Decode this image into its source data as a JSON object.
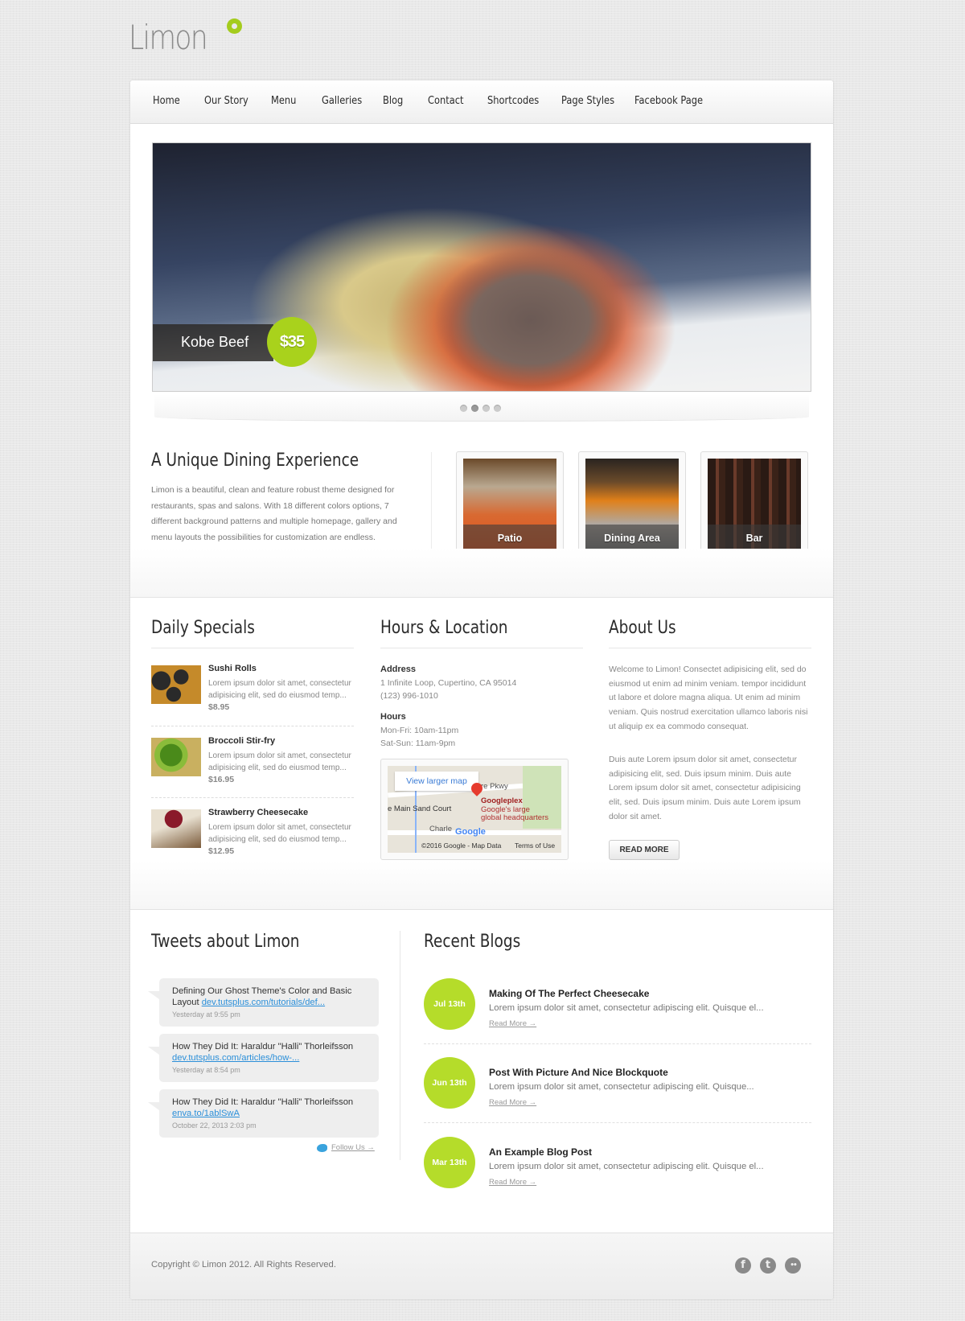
{
  "brand": {
    "name": "Limon",
    "accent": "#a9d21c"
  },
  "nav": {
    "items": [
      {
        "label": "Home"
      },
      {
        "label": "Our Story"
      },
      {
        "label": "Menu"
      },
      {
        "label": "Galleries"
      },
      {
        "label": "Blog"
      },
      {
        "label": "Contact"
      },
      {
        "label": "Shortcodes"
      },
      {
        "label": "Page Styles"
      },
      {
        "label": "Facebook Page"
      }
    ]
  },
  "slider": {
    "caption": "Kobe Beef",
    "price": "$35",
    "slide_count": 4,
    "active_slide": 2
  },
  "intro": {
    "title": "A Unique Dining Experience",
    "text": "Limon is a beautiful, clean and feature robust theme designed for restaurants, spas and salons. With 18 different colors options, 7 different background patterns and multiple homepage, gallery and menu layouts the possibilities for customization are endless.",
    "gallery": [
      {
        "label": "Patio"
      },
      {
        "label": "Dining Area"
      },
      {
        "label": "Bar"
      }
    ]
  },
  "daily_specials": {
    "title": "Daily Specials",
    "items": [
      {
        "name": "Sushi Rolls",
        "desc": "Lorem ipsum dolor sit amet, consectetur adipisicing elit, sed do eiusmod temp...",
        "price": "$8.95"
      },
      {
        "name": "Broccoli Stir-fry",
        "desc": "Lorem ipsum dolor sit amet, consectetur adipisicing elit, sed do eiusmod temp...",
        "price": "$16.95"
      },
      {
        "name": "Strawberry Cheesecake",
        "desc": "Lorem ipsum dolor sit amet, consectetur adipisicing elit, sed do eiusmod temp...",
        "price": "$12.95"
      }
    ]
  },
  "hours_location": {
    "title": "Hours & Location",
    "address_label": "Address",
    "address": "1 Infinite Loop, Cupertino, CA 95014",
    "phone": "(123) 996-1010",
    "hours_label": "Hours",
    "weekday": "Mon-Fri: 10am-11pm",
    "weekend": "Sat-Sun: 11am-9pm",
    "map": {
      "button": "View larger map",
      "street_1": "re Pkwy",
      "street_2": "e Main Sand Court",
      "street_3": "Charle",
      "place_name": "Googleplex",
      "place_desc_1": "Google's large",
      "place_desc_2": "global headquarters",
      "logo": "Google",
      "attribution": "©2016 Google - Map Data",
      "terms": "Terms of Use"
    }
  },
  "about": {
    "title": "About Us",
    "para1": "Welcome to Limon! Consectet adipisicing elit, sed do eiusmod ut enim ad minim veniam. tempor incididunt ut labore et dolore magna aliqua. Ut enim ad minim veniam. Quis nostrud exercitation ullamco laboris nisi ut aliquip ex ea commodo consequat.",
    "para2": "Duis aute Lorem ipsum dolor sit amet, consectetur adipisicing elit, sed. Duis ipsum minim. Duis aute Lorem ipsum dolor sit amet, consectetur adipisicing elit, sed. Duis ipsum minim. Duis aute Lorem ipsum dolor sit amet.",
    "button": "READ MORE"
  },
  "tweets": {
    "title": "Tweets about Limon",
    "items": [
      {
        "text": "Defining Our Ghost Theme's Color and Basic Layout ",
        "link": "dev.tutsplus.com/tutorials/def...",
        "time": "Yesterday at 9:55 pm"
      },
      {
        "text": "How They Did It: Haraldur \"Halli\" Thorleifsson ",
        "link": "dev.tutsplus.com/articles/how-...",
        "time": "Yesterday at 8:54 pm"
      },
      {
        "text": "How They Did It: Haraldur \"Halli\" Thorleifsson ",
        "link": "enva.to/1ablSwA",
        "time": "October 22, 2013 2:03 pm"
      }
    ],
    "follow": "Follow Us →"
  },
  "blogs": {
    "title": "Recent Blogs",
    "items": [
      {
        "date": "Jul 13th",
        "title": "Making Of The Perfect Cheesecake",
        "excerpt": "Lorem ipsum dolor sit amet, consectetur adipiscing elit. Quisque el...",
        "more": "Read More →"
      },
      {
        "date": "Jun 13th",
        "title": "Post With Picture And Nice Blockquote",
        "excerpt": "Lorem ipsum dolor sit amet, consectetur adipiscing elit. Quisque...",
        "more": "Read More →"
      },
      {
        "date": "Mar 13th",
        "title": "An Example Blog Post",
        "excerpt": "Lorem ipsum dolor sit amet, consectetur adipiscing elit. Quisque el...",
        "more": "Read More →"
      }
    ]
  },
  "footer": {
    "copyright": "Copyright © Limon 2012. All Rights Reserved.",
    "social": [
      {
        "name": "facebook",
        "glyph": "f"
      },
      {
        "name": "tumblr",
        "glyph": "t"
      },
      {
        "name": "flickr",
        "glyph": "••"
      }
    ]
  }
}
